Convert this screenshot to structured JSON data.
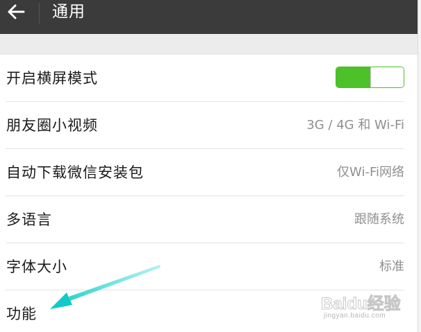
{
  "header": {
    "back_icon": "arrow-left-icon",
    "title": "通用"
  },
  "settings": {
    "rows": [
      {
        "label": "开启横屏模式",
        "control": "toggle",
        "toggle_on": true,
        "accent": "#4cc129"
      },
      {
        "label": "朋友圈小视频",
        "value": "3G / 4G 和 Wi-Fi"
      },
      {
        "label": "自动下载微信安装包",
        "value": "仅Wi-Fi网络"
      },
      {
        "label": "多语言",
        "value": "跟随系统"
      },
      {
        "label": "字体大小",
        "value": "标准"
      },
      {
        "label": "功能"
      }
    ]
  },
  "annotation": {
    "type": "arrow",
    "color": "#2fd9d4",
    "points_to": "功能"
  },
  "watermark": {
    "logo": "Baidu经验",
    "url": "jingyan.baidu.com"
  }
}
